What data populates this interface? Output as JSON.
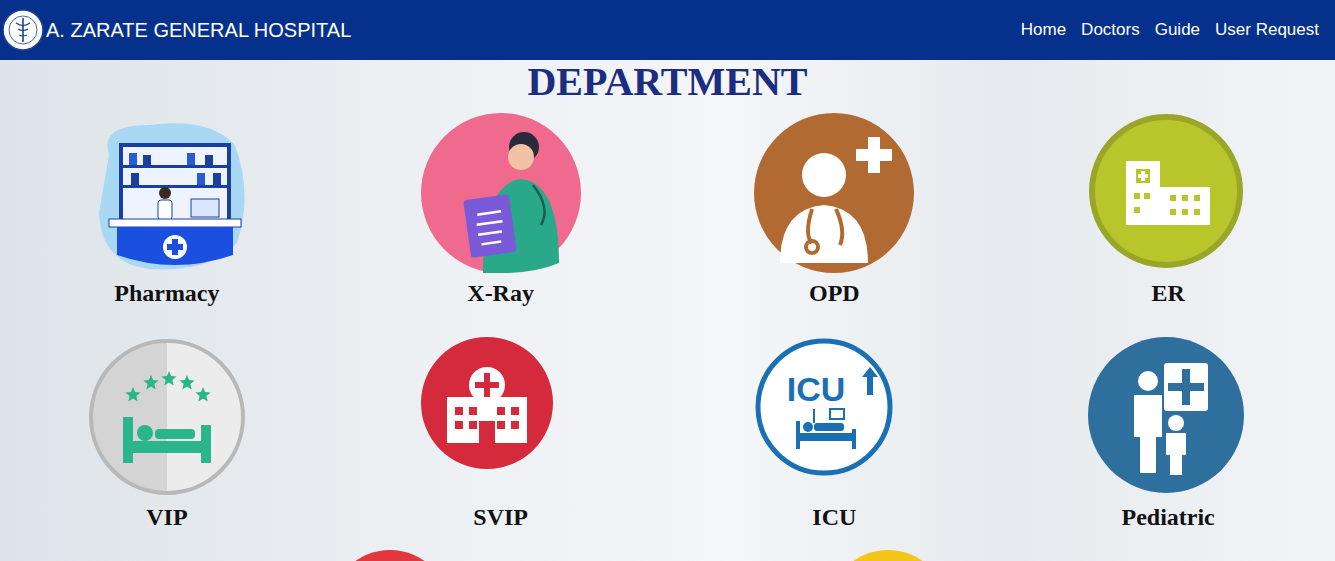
{
  "header": {
    "brand": "A. ZARATE GENERAL HOSPITAL",
    "nav": [
      {
        "label": "Home"
      },
      {
        "label": "Doctors"
      },
      {
        "label": "Guide"
      },
      {
        "label": "User Request"
      }
    ]
  },
  "title": "DEPARTMENT",
  "departments": [
    {
      "name": "Pharmacy",
      "color": "#a9d8f5"
    },
    {
      "name": "X-Ray",
      "color": "#f06a8e"
    },
    {
      "name": "OPD",
      "color": "#b06a32"
    },
    {
      "name": "ER",
      "color": "#b8c62c"
    },
    {
      "name": "VIP",
      "color": "#d4d4d4"
    },
    {
      "name": "SVIP",
      "color": "#d52a3b"
    },
    {
      "name": "ICU",
      "color": "#1a6fb5",
      "icon_label": "ICU"
    },
    {
      "name": "Pediatric",
      "color": "#2f6f9e"
    }
  ],
  "more_departments": [
    {
      "color": "#e0383e"
    },
    {
      "color": "#f5c518"
    }
  ]
}
